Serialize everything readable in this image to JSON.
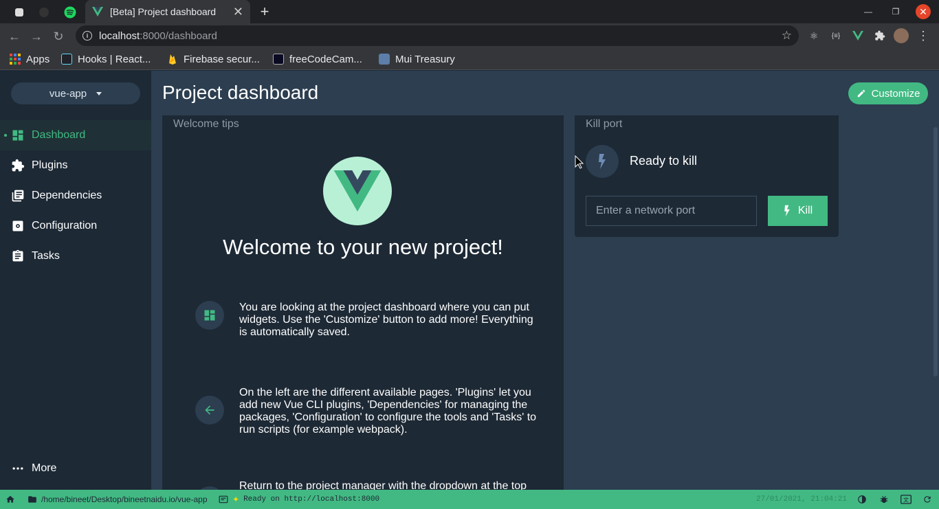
{
  "browser": {
    "active_tab_title": "[Beta] Project dashboard",
    "url_host": "localhost",
    "url_rest": ":8000/dashboard",
    "bookmarks": [
      {
        "label": "Apps"
      },
      {
        "label": "Hooks | React..."
      },
      {
        "label": "Firebase secur..."
      },
      {
        "label": "freeCodeCam..."
      },
      {
        "label": "Mui Treasury"
      }
    ]
  },
  "sidebar": {
    "project": "vue-app",
    "items": [
      {
        "label": "Dashboard",
        "icon": "dashboard-icon",
        "active": true
      },
      {
        "label": "Plugins",
        "icon": "puzzle-icon"
      },
      {
        "label": "Dependencies",
        "icon": "library-icon"
      },
      {
        "label": "Configuration",
        "icon": "settings-icon"
      },
      {
        "label": "Tasks",
        "icon": "assignment-icon"
      }
    ],
    "more": "More"
  },
  "main": {
    "title": "Project dashboard",
    "customize": "Customize"
  },
  "welcome_widget": {
    "title": "Welcome tips",
    "heading": "Welcome to your new project!",
    "tips": [
      "You are looking at the project dashboard where you can put widgets. Use the 'Customize' button to add more! Everything is automatically saved.",
      "On the left are the different available pages. 'Plugins' let you add new Vue CLI plugins, 'Dependencies' for managing the packages, 'Configuration' to configure the tools and 'Tasks' to run scripts (for example webpack).",
      "Return to the project manager with the dropdown at the top"
    ]
  },
  "kill_widget": {
    "title": "Kill port",
    "status": "Ready to kill",
    "placeholder": "Enter a network port",
    "button": "Kill"
  },
  "statusbar": {
    "path": "/home/bineet/Desktop/bineetnaidu.io/vue-app",
    "log": "Ready on http://localhost:8000",
    "datetime": "27/01/2021, 21:04:21"
  },
  "colors": {
    "accent": "#42b983",
    "sidebar_bg": "#1d2935",
    "main_bg": "#2c3e50"
  }
}
